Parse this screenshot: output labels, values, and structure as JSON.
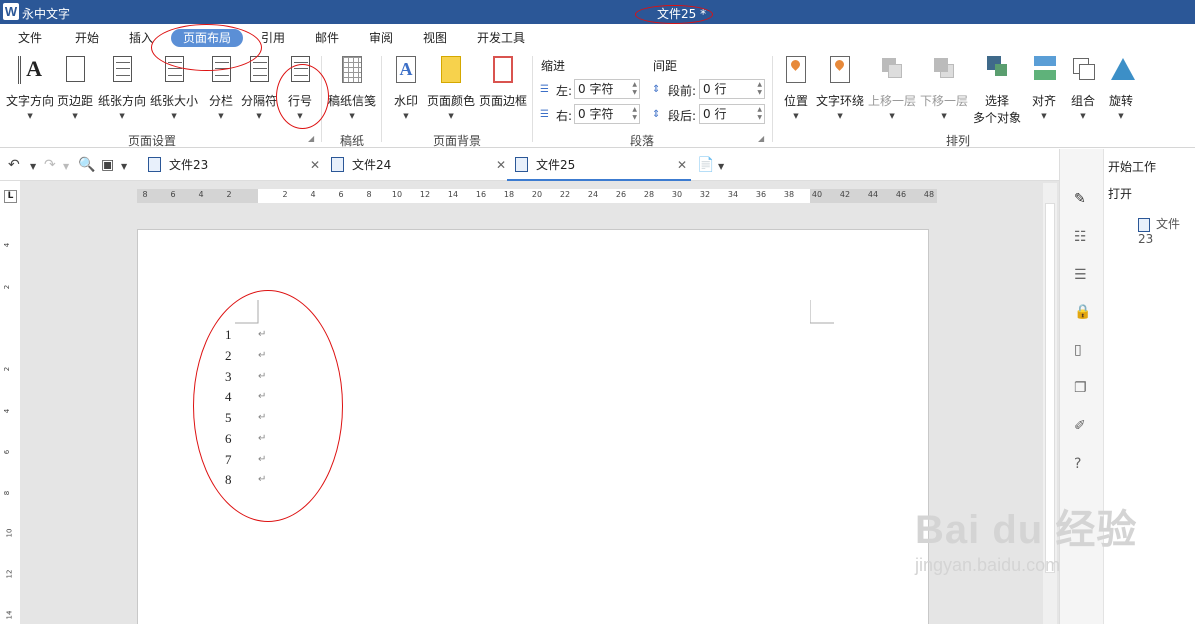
{
  "titlebar": {
    "app_name": "永中文字",
    "doc_title": "文件25 *"
  },
  "menu": [
    "文件",
    "开始",
    "插入",
    "页面布局",
    "引用",
    "邮件",
    "审阅",
    "视图",
    "开发工具"
  ],
  "menu_active": "页面布局",
  "ribbon": {
    "page_setup": {
      "group_label": "页面设置",
      "buttons": [
        "文字方向",
        "页边距",
        "纸张方向",
        "纸张大小",
        "分栏",
        "分隔符",
        "行号"
      ]
    },
    "manuscript": {
      "group_label": "稿纸",
      "buttons": [
        "稿纸信笺"
      ]
    },
    "background": {
      "group_label": "页面背景",
      "buttons": [
        "水印",
        "页面颜色",
        "页面边框"
      ]
    },
    "paragraph": {
      "group_label": "段落",
      "indent_label": "缩进",
      "spacing_label": "间距",
      "left_label": "左:",
      "right_label": "右:",
      "left_value": "0 字符",
      "right_value": "0 字符",
      "before_label": "段前:",
      "after_label": "段后:",
      "before_value": "0 行",
      "after_value": "0 行"
    },
    "arrange": {
      "group_label": "排列",
      "buttons": [
        "位置",
        "文字环绕",
        "上移一层",
        "下移一层",
        "选择",
        "多个对象",
        "对齐",
        "组合",
        "旋转"
      ]
    }
  },
  "tabs": [
    {
      "label": "文件23",
      "active": false
    },
    {
      "label": "文件24",
      "active": false
    },
    {
      "label": "文件25",
      "active": true
    }
  ],
  "ruler": {
    "horizontal": [
      "8",
      "6",
      "4",
      "2",
      "2",
      "4",
      "6",
      "8",
      "10",
      "12",
      "14",
      "16",
      "18",
      "20",
      "22",
      "24",
      "26",
      "28",
      "30",
      "32",
      "34",
      "36",
      "38",
      "40",
      "42",
      "44",
      "46",
      "48"
    ],
    "corner": "L",
    "vertical": [
      "4",
      "2",
      "2",
      "4",
      "6",
      "8",
      "10",
      "12",
      "14"
    ]
  },
  "document": {
    "line_numbers": [
      "1",
      "2",
      "3",
      "4",
      "5",
      "6",
      "7",
      "8"
    ],
    "paragraph_mark": "↵"
  },
  "right_panel": {
    "title": "开始工作",
    "open": "打开",
    "recent": "文件23"
  },
  "watermark": {
    "big": "Bai du 经验",
    "small": "jingyan.baidu.com"
  },
  "colors": {
    "titlebar": "#2b5797",
    "active_tab": "#5b8fd6",
    "annotation": "#d11111"
  }
}
